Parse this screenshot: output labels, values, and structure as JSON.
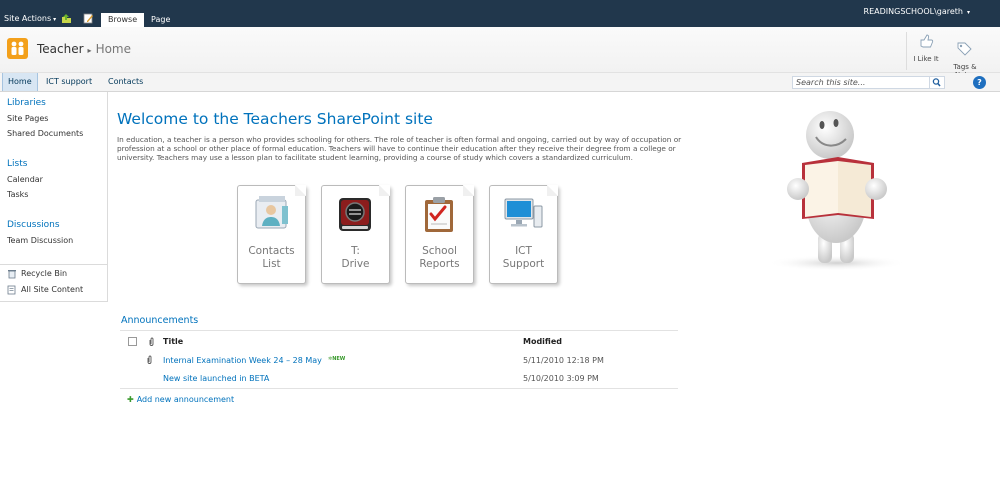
{
  "ribbon": {
    "site_actions": "Site Actions",
    "tabs": [
      "Browse",
      "Page"
    ],
    "user": "READINGSCHOOL\\gareth"
  },
  "title_area": {
    "site": "Teacher",
    "page": "Home",
    "social": [
      {
        "label": "I Like It",
        "icon": "thumbs-up-icon"
      },
      {
        "label": "Tags &\nNotes",
        "icon": "tags-notes-icon"
      }
    ]
  },
  "topnav": {
    "items": [
      "Home",
      "ICT support",
      "Contacts"
    ],
    "search_placeholder": "Search this site..."
  },
  "quicklaunch": {
    "sections": [
      {
        "heading": "Libraries",
        "links": [
          "Site Pages",
          "Shared Documents"
        ]
      },
      {
        "heading": "Lists",
        "links": [
          "Calendar",
          "Tasks"
        ]
      },
      {
        "heading": "Discussions",
        "links": [
          "Team Discussion"
        ]
      }
    ],
    "bottom": [
      "Recycle Bin",
      "All Site Content"
    ]
  },
  "main": {
    "welcome": "Welcome to the Teachers SharePoint site",
    "intro": "In education, a teacher is a person who provides schooling for others. The role of teacher is often formal and ongoing, carried out by way of occupation  or profession  at a school  or other place of formal education. Teachers will have to continue their education after they receive their degree from a college or university. Teachers may use a lesson plan to facilitate student learning, providing a course of study which covers a standardized curriculum.",
    "tiles": [
      {
        "label": "Contacts\nList",
        "icon": "contacts-list-icon"
      },
      {
        "label": "T:\nDrive",
        "icon": "drive-icon"
      },
      {
        "label": "School\nReports",
        "icon": "clipboard-report-icon"
      },
      {
        "label": "ICT\nSupport",
        "icon": "computer-icon"
      }
    ]
  },
  "announcements": {
    "title": "Announcements",
    "columns": [
      "Title",
      "Modified"
    ],
    "rows": [
      {
        "title": "Internal Examination Week 24 – 28 May",
        "modified": "5/11/2010 12:18 PM",
        "badge": "NEW",
        "attachment": true
      },
      {
        "title": "New site launched in BETA",
        "modified": "5/10/2010 3:09 PM",
        "badge": "",
        "attachment": false
      }
    ],
    "add_link": "Add new announcement"
  },
  "colors": {
    "ribbon_bg": "#21374c",
    "link_blue": "#0072bc",
    "logo_orange": "#f3a01b",
    "new_green": "#3a9a2d"
  }
}
